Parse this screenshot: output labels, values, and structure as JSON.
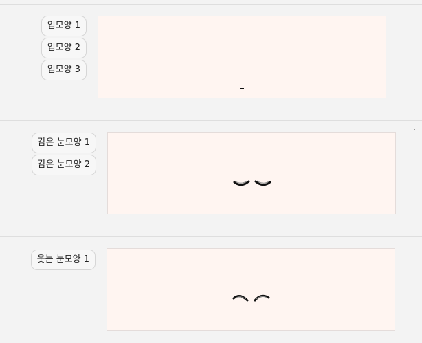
{
  "colors": {
    "page_background": "#f3f3f3",
    "preview_background": "#fff5f1",
    "divider": "#dedede",
    "feature_stroke": "#111111"
  },
  "sections": [
    {
      "id": "mouth",
      "buttons": [
        "입모양 1",
        "입모양 2",
        "입모양 3"
      ],
      "preview_icon": "mouth-line-icon"
    },
    {
      "id": "closed-eyes",
      "buttons": [
        "감은 눈모양 1",
        "감은 눈모양 2"
      ],
      "preview_icon": "closed-eyes-icon"
    },
    {
      "id": "smiling-eyes",
      "buttons": [
        "웃는 눈모양 1"
      ],
      "preview_icon": "smiling-eyes-icon"
    }
  ]
}
